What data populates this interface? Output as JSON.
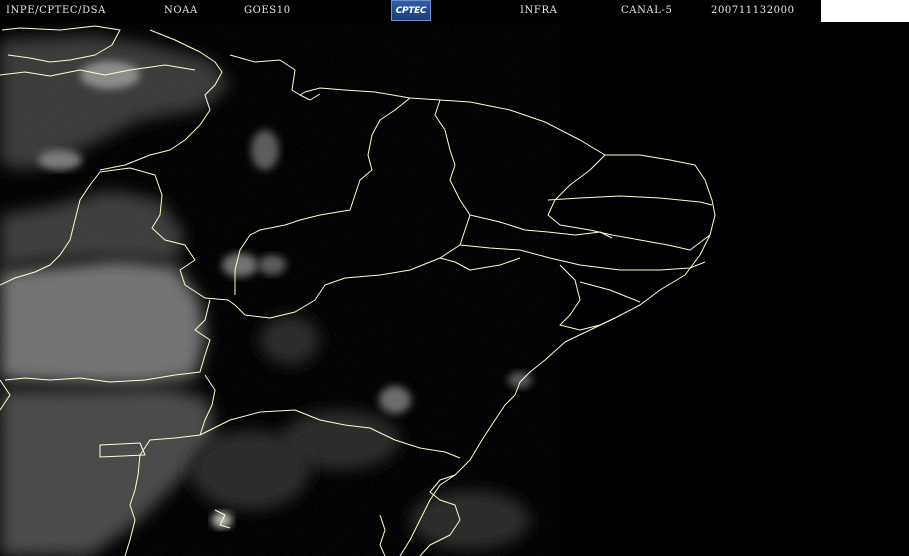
{
  "header": {
    "source": "INPE/CPTEC/DSA",
    "agency": "NOAA",
    "satellite": "GOES10",
    "logo_text": "CPTEC",
    "band": "INFRA",
    "channel": "CANAL-5",
    "timestamp": "200711132000"
  },
  "colors": {
    "background": "#000000",
    "coastline": "#ffffcc",
    "cloud": "#8a8a8a",
    "label_text": "#e8e8e8",
    "logo_blue": "#2f5fa8"
  }
}
